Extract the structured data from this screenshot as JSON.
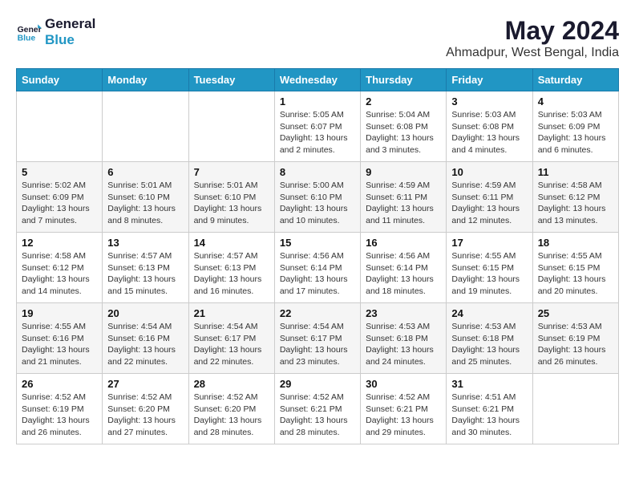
{
  "logo": {
    "line1": "General",
    "line2": "Blue"
  },
  "title": "May 2024",
  "location": "Ahmadpur, West Bengal, India",
  "weekdays": [
    "Sunday",
    "Monday",
    "Tuesday",
    "Wednesday",
    "Thursday",
    "Friday",
    "Saturday"
  ],
  "weeks": [
    [
      {
        "day": "",
        "details": ""
      },
      {
        "day": "",
        "details": ""
      },
      {
        "day": "",
        "details": ""
      },
      {
        "day": "1",
        "details": "Sunrise: 5:05 AM\nSunset: 6:07 PM\nDaylight: 13 hours\nand 2 minutes."
      },
      {
        "day": "2",
        "details": "Sunrise: 5:04 AM\nSunset: 6:08 PM\nDaylight: 13 hours\nand 3 minutes."
      },
      {
        "day": "3",
        "details": "Sunrise: 5:03 AM\nSunset: 6:08 PM\nDaylight: 13 hours\nand 4 minutes."
      },
      {
        "day": "4",
        "details": "Sunrise: 5:03 AM\nSunset: 6:09 PM\nDaylight: 13 hours\nand 6 minutes."
      }
    ],
    [
      {
        "day": "5",
        "details": "Sunrise: 5:02 AM\nSunset: 6:09 PM\nDaylight: 13 hours\nand 7 minutes."
      },
      {
        "day": "6",
        "details": "Sunrise: 5:01 AM\nSunset: 6:10 PM\nDaylight: 13 hours\nand 8 minutes."
      },
      {
        "day": "7",
        "details": "Sunrise: 5:01 AM\nSunset: 6:10 PM\nDaylight: 13 hours\nand 9 minutes."
      },
      {
        "day": "8",
        "details": "Sunrise: 5:00 AM\nSunset: 6:10 PM\nDaylight: 13 hours\nand 10 minutes."
      },
      {
        "day": "9",
        "details": "Sunrise: 4:59 AM\nSunset: 6:11 PM\nDaylight: 13 hours\nand 11 minutes."
      },
      {
        "day": "10",
        "details": "Sunrise: 4:59 AM\nSunset: 6:11 PM\nDaylight: 13 hours\nand 12 minutes."
      },
      {
        "day": "11",
        "details": "Sunrise: 4:58 AM\nSunset: 6:12 PM\nDaylight: 13 hours\nand 13 minutes."
      }
    ],
    [
      {
        "day": "12",
        "details": "Sunrise: 4:58 AM\nSunset: 6:12 PM\nDaylight: 13 hours\nand 14 minutes."
      },
      {
        "day": "13",
        "details": "Sunrise: 4:57 AM\nSunset: 6:13 PM\nDaylight: 13 hours\nand 15 minutes."
      },
      {
        "day": "14",
        "details": "Sunrise: 4:57 AM\nSunset: 6:13 PM\nDaylight: 13 hours\nand 16 minutes."
      },
      {
        "day": "15",
        "details": "Sunrise: 4:56 AM\nSunset: 6:14 PM\nDaylight: 13 hours\nand 17 minutes."
      },
      {
        "day": "16",
        "details": "Sunrise: 4:56 AM\nSunset: 6:14 PM\nDaylight: 13 hours\nand 18 minutes."
      },
      {
        "day": "17",
        "details": "Sunrise: 4:55 AM\nSunset: 6:15 PM\nDaylight: 13 hours\nand 19 minutes."
      },
      {
        "day": "18",
        "details": "Sunrise: 4:55 AM\nSunset: 6:15 PM\nDaylight: 13 hours\nand 20 minutes."
      }
    ],
    [
      {
        "day": "19",
        "details": "Sunrise: 4:55 AM\nSunset: 6:16 PM\nDaylight: 13 hours\nand 21 minutes."
      },
      {
        "day": "20",
        "details": "Sunrise: 4:54 AM\nSunset: 6:16 PM\nDaylight: 13 hours\nand 22 minutes."
      },
      {
        "day": "21",
        "details": "Sunrise: 4:54 AM\nSunset: 6:17 PM\nDaylight: 13 hours\nand 22 minutes."
      },
      {
        "day": "22",
        "details": "Sunrise: 4:54 AM\nSunset: 6:17 PM\nDaylight: 13 hours\nand 23 minutes."
      },
      {
        "day": "23",
        "details": "Sunrise: 4:53 AM\nSunset: 6:18 PM\nDaylight: 13 hours\nand 24 minutes."
      },
      {
        "day": "24",
        "details": "Sunrise: 4:53 AM\nSunset: 6:18 PM\nDaylight: 13 hours\nand 25 minutes."
      },
      {
        "day": "25",
        "details": "Sunrise: 4:53 AM\nSunset: 6:19 PM\nDaylight: 13 hours\nand 26 minutes."
      }
    ],
    [
      {
        "day": "26",
        "details": "Sunrise: 4:52 AM\nSunset: 6:19 PM\nDaylight: 13 hours\nand 26 minutes."
      },
      {
        "day": "27",
        "details": "Sunrise: 4:52 AM\nSunset: 6:20 PM\nDaylight: 13 hours\nand 27 minutes."
      },
      {
        "day": "28",
        "details": "Sunrise: 4:52 AM\nSunset: 6:20 PM\nDaylight: 13 hours\nand 28 minutes."
      },
      {
        "day": "29",
        "details": "Sunrise: 4:52 AM\nSunset: 6:21 PM\nDaylight: 13 hours\nand 28 minutes."
      },
      {
        "day": "30",
        "details": "Sunrise: 4:52 AM\nSunset: 6:21 PM\nDaylight: 13 hours\nand 29 minutes."
      },
      {
        "day": "31",
        "details": "Sunrise: 4:51 AM\nSunset: 6:21 PM\nDaylight: 13 hours\nand 30 minutes."
      },
      {
        "day": "",
        "details": ""
      }
    ]
  ]
}
